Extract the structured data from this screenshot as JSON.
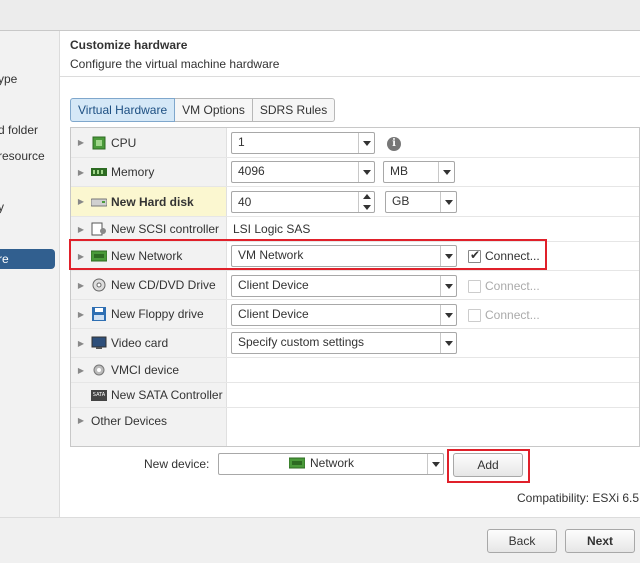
{
  "sidebar": {
    "items": [
      {
        "label": "ype",
        "active": false
      },
      {
        "label": "d folder",
        "active": false
      },
      {
        "label": "resource",
        "active": false
      },
      {
        "label": "y",
        "active": false
      },
      {
        "label": "re",
        "active": true
      }
    ]
  },
  "header": {
    "title": "Customize hardware",
    "subtitle": "Configure the virtual machine hardware"
  },
  "tabs": [
    {
      "label": "Virtual Hardware",
      "active": true
    },
    {
      "label": "VM Options",
      "active": false
    },
    {
      "label": "SDRS Rules",
      "active": false
    }
  ],
  "hardware": {
    "cpu": {
      "label": "CPU",
      "icon": "cpu-icon",
      "value": "1"
    },
    "memory": {
      "label": "Memory",
      "icon": "memory-icon",
      "value": "4096",
      "unit": "MB"
    },
    "hard_disk": {
      "label": "New Hard disk",
      "icon": "hard-disk-icon",
      "value": "40",
      "unit": "GB"
    },
    "scsi": {
      "label": "New SCSI controller",
      "icon": "scsi-controller-icon",
      "value": "LSI Logic SAS"
    },
    "network": {
      "label": "New Network",
      "icon": "network-icon",
      "value": "VM Network",
      "connect_label": "Connect...",
      "connected": true
    },
    "cd_dvd": {
      "label": "New CD/DVD Drive",
      "icon": "cd-dvd-icon",
      "value": "Client Device",
      "connect_label": "Connect...",
      "connected": false
    },
    "floppy": {
      "label": "New Floppy drive",
      "icon": "floppy-icon",
      "value": "Client Device",
      "connect_label": "Connect...",
      "connected": false
    },
    "video": {
      "label": "Video card",
      "icon": "video-card-icon",
      "value": "Specify custom settings"
    },
    "vmci": {
      "label": "VMCI device",
      "icon": "vmci-gear-icon"
    },
    "sata": {
      "label": "New SATA Controller",
      "icon": "sata-icon",
      "icon_text": "SATA"
    },
    "other": {
      "label": "Other Devices"
    }
  },
  "new_device": {
    "label": "New device:",
    "value": "Network",
    "add_label": "Add"
  },
  "compatibility": "Compatibility: ESXi 6.5",
  "footer": {
    "back_label": "Back",
    "next_label": "Next"
  },
  "colors": {
    "accent": "#315f8f",
    "highlight_box": "#e0202a",
    "tab_active_bg": "#d5e8f7",
    "new_item_bg": "#fbf7d0"
  }
}
